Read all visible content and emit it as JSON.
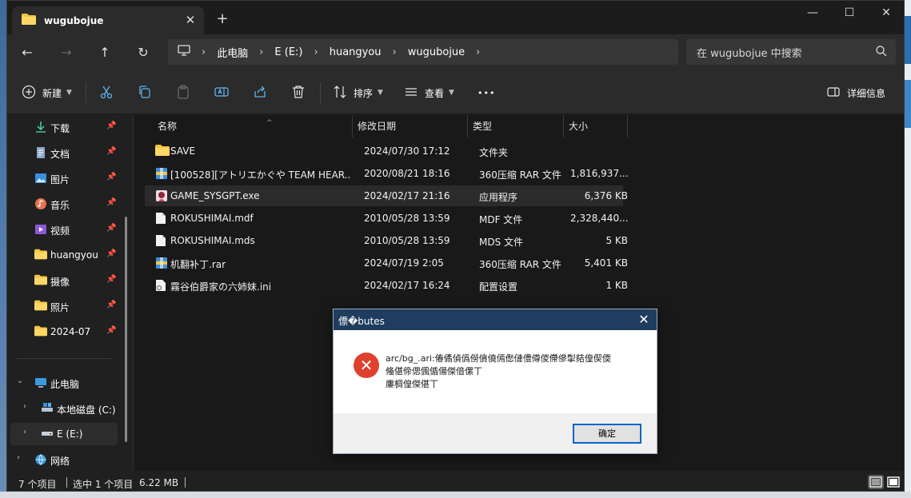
{
  "window": {
    "tab_title": "wugubojue",
    "tab_close": "✕",
    "tab_add": "+",
    "controls": {
      "minimize": "—",
      "maximize": "☐",
      "close": "✕"
    }
  },
  "nav": {
    "back": "←",
    "forward": "→",
    "up": "↑",
    "refresh": "↻",
    "breadcrumbs": [
      "此电脑",
      "E (E:)",
      "huangyou",
      "wugubojue"
    ],
    "search_placeholder": "在 wugubojue 中搜索"
  },
  "toolbar": {
    "new_label": "新建",
    "sort_label": "排序",
    "view_label": "查看",
    "more_label": "•••",
    "details_label": "详细信息"
  },
  "sidebar": {
    "quick": [
      {
        "label": "下载",
        "icon": "download-icon"
      },
      {
        "label": "文档",
        "icon": "document-icon"
      },
      {
        "label": "图片",
        "icon": "pictures-icon"
      },
      {
        "label": "音乐",
        "icon": "music-icon"
      },
      {
        "label": "视频",
        "icon": "video-icon"
      },
      {
        "label": "huangyou",
        "icon": "folder-icon"
      },
      {
        "label": "摄像",
        "icon": "folder-icon"
      },
      {
        "label": "照片",
        "icon": "folder-icon"
      },
      {
        "label": "2024-07",
        "icon": "folder-icon"
      }
    ],
    "this_pc": "此电脑",
    "drive_c": "本地磁盘 (C:)",
    "drive_e": "E (E:)",
    "network": "网络"
  },
  "columns": {
    "name": "名称",
    "date": "修改日期",
    "type": "类型",
    "size": "大小"
  },
  "files": [
    {
      "name": "SAVE",
      "date": "2024/07/30 17:12",
      "type": "文件夹",
      "size": "",
      "icon": "folder-icon"
    },
    {
      "name": "[100528][アトリエかぐや TEAM HEAR...",
      "date": "2020/08/21 18:16",
      "type": "360压缩 RAR 文件",
      "size": "1,816,937...",
      "icon": "rar-archive-icon"
    },
    {
      "name": "GAME_SYSGPT.exe",
      "date": "2024/02/17 21:16",
      "type": "应用程序",
      "size": "6,376 KB",
      "icon": "app-icon"
    },
    {
      "name": "ROKUSHIMAI.mdf",
      "date": "2010/05/28 13:59",
      "type": "MDF 文件",
      "size": "2,328,440...",
      "icon": "file-icon"
    },
    {
      "name": "ROKUSHIMAI.mds",
      "date": "2010/05/28 13:59",
      "type": "MDS 文件",
      "size": "5 KB",
      "icon": "file-icon"
    },
    {
      "name": "机翻补丁.rar",
      "date": "2024/07/19 2:05",
      "type": "360压缩 RAR 文件",
      "size": "5,401 KB",
      "icon": "rar-archive-icon"
    },
    {
      "name": "霧谷伯爵家の六姉妹.ini",
      "date": "2024/02/17 16:24",
      "type": "配置设置",
      "size": "1 KB",
      "icon": "settings-file-icon"
    }
  ],
  "status": {
    "item_count": "7 个项目",
    "selection": "选中 1 个项目",
    "size": "6.22 MB"
  },
  "dialog": {
    "title": "僄�butes",
    "close": "✕",
    "message_line1": "arc/bg_.ari:偆僪偵僞僗僋僥傿僽僆僼僔儍僀傪揱夡偟偰偄",
    "message_line2": "偹偡偙偲偑偱偒傑偣傫丅",
    "message_line3": "廔椆偟傑偡丅",
    "ok_label": "确定"
  },
  "colors": {
    "window_bg": "#202020",
    "accent": "#0a64c8",
    "folder": "#f4c542",
    "error": "#e0412f"
  }
}
